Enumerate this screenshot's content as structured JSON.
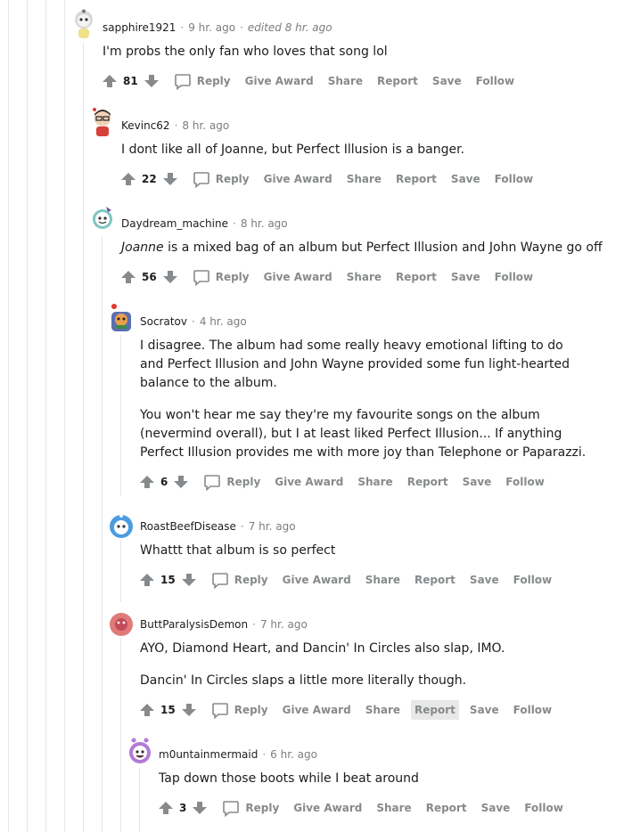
{
  "comments": [
    {
      "author": "sapphire1921",
      "time": "9 hr. ago",
      "edited": "edited 8 hr. ago",
      "paragraphs": [
        "I'm probs the only fan who loves that song lol"
      ],
      "score": "81",
      "avatar_color": "#c8c8c8"
    },
    {
      "author": "Kevinc62",
      "time": "8 hr. ago",
      "paragraphs": [
        "I dont like all of Joanne, but Perfect Illusion is a banger."
      ],
      "score": "22",
      "avatar_color": "#d6403a"
    },
    {
      "author": "Daydream_machine",
      "time": "8 hr. ago",
      "italic_lead": "Joanne",
      "paragraphs": [
        " is a mixed bag of an album but Perfect Illusion and John Wayne go off"
      ],
      "score": "56",
      "avatar_color": "#7ec6c5"
    },
    {
      "author": "Socratov",
      "time": "4 hr. ago",
      "paragraphs": [
        "I disagree. The album had some really heavy emotional lifting to do and Perfect Illusion and John Wayne provided some fun light-hearted balance to the album.",
        "You won't hear me say they're my favourite songs on the album (nevermind overall), but I at least liked Perfect Illusion... If anything Perfect Illusion provides me with more joy than Telephone or Paparazzi."
      ],
      "score": "6",
      "avatar_color": "#5b6fb0"
    },
    {
      "author": "RoastBeefDisease",
      "time": "7 hr. ago",
      "paragraphs": [
        "Whattt that album is so perfect"
      ],
      "score": "15",
      "avatar_color": "#4b9ce0"
    },
    {
      "author": "ButtParalysisDemon",
      "time": "7 hr. ago",
      "paragraphs": [
        "AYO, Diamond Heart, and Dancin' In Circles also slap, IMO.",
        "Dancin' In Circles slaps a little more literally though."
      ],
      "score": "15",
      "avatar_color": "#e07a7a"
    },
    {
      "author": "m0untainmermaid",
      "time": "6 hr. ago",
      "paragraphs": [
        "Tap down those boots while I beat around"
      ],
      "score": "3",
      "avatar_color": "#b27ad6"
    }
  ],
  "actions": {
    "reply": "Reply",
    "give_award": "Give Award",
    "share": "Share",
    "report": "Report",
    "save": "Save",
    "follow": "Follow"
  },
  "separator": "·"
}
